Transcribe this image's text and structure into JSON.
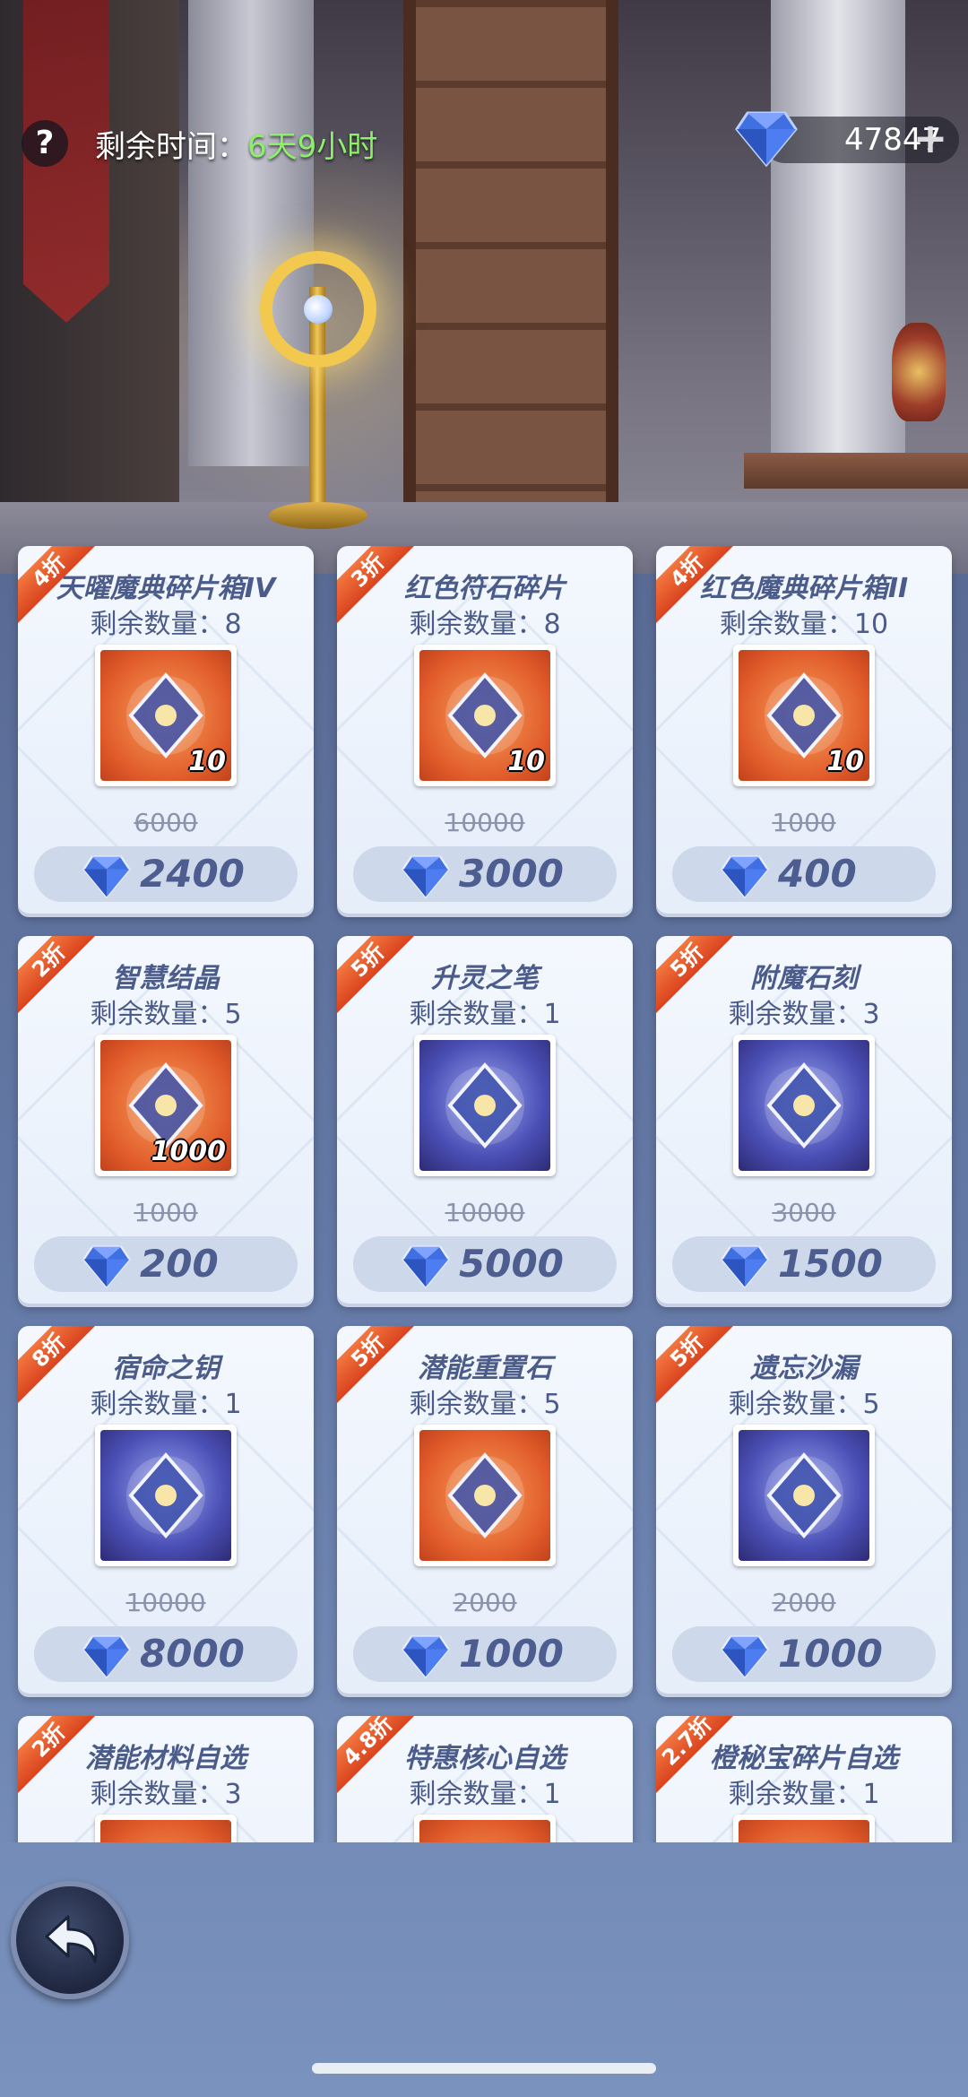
{
  "hud": {
    "help_label": "?",
    "timer_label": "剩余时间：",
    "timer_value": "6天9小时",
    "gem_count": "47847",
    "add_label": "+"
  },
  "icons": {
    "help": "question-icon",
    "currency": "diamond-gem-icon",
    "add": "plus-icon",
    "back": "undo-arrow-icon"
  },
  "colors": {
    "timer_value": "#8ef06a",
    "discount_badge": "#e4552a",
    "price_text": "#4d5d8f",
    "gem": "#3f6fe0"
  },
  "items": [
    {
      "discount": "4折",
      "name": "天曜魔典碎片箱IV",
      "qty": "剩余数量：8",
      "count": "10",
      "old_price": "6000",
      "price": "2400",
      "icon": "treasure-chest-red-icon"
    },
    {
      "discount": "3折",
      "name": "红色符石碎片",
      "qty": "剩余数量：8",
      "count": "10",
      "old_price": "10000",
      "price": "3000",
      "icon": "red-rune-stone-icon"
    },
    {
      "discount": "4折",
      "name": "红色魔典碎片箱II",
      "qty": "剩余数量：10",
      "count": "10",
      "old_price": "1000",
      "price": "400",
      "icon": "treasure-chest-blue-icon"
    },
    {
      "discount": "2折",
      "name": "智慧结晶",
      "qty": "剩余数量：5",
      "count": "1000",
      "old_price": "1000",
      "price": "200",
      "icon": "wisdom-crystal-icon"
    },
    {
      "discount": "5折",
      "name": "升灵之笔",
      "qty": "剩余数量：1",
      "count": "",
      "old_price": "10000",
      "price": "5000",
      "icon": "feather-quill-icon"
    },
    {
      "discount": "5折",
      "name": "附魔石刻",
      "qty": "剩余数量：3",
      "count": "",
      "old_price": "3000",
      "price": "1500",
      "icon": "enchant-stone-icon"
    },
    {
      "discount": "8折",
      "name": "宿命之钥",
      "qty": "剩余数量：1",
      "count": "",
      "old_price": "10000",
      "price": "8000",
      "icon": "fate-key-icon"
    },
    {
      "discount": "5折",
      "name": "潜能重置石",
      "qty": "剩余数量：5",
      "count": "",
      "old_price": "2000",
      "price": "1000",
      "icon": "potential-reset-stone-icon"
    },
    {
      "discount": "5折",
      "name": "遗忘沙漏",
      "qty": "剩余数量：5",
      "count": "",
      "old_price": "2000",
      "price": "1000",
      "icon": "hourglass-icon"
    },
    {
      "discount": "2折",
      "name": "潜能材料自选",
      "qty": "剩余数量：3",
      "count": "",
      "old_price": "",
      "price": "",
      "icon": "material-select-icon"
    },
    {
      "discount": "4.8折",
      "name": "特惠核心自选",
      "qty": "剩余数量：1",
      "count": "",
      "old_price": "",
      "price": "",
      "icon": "core-select-icon"
    },
    {
      "discount": "2.7折",
      "name": "橙秘宝碎片自选",
      "qty": "剩余数量：1",
      "count": "",
      "old_price": "",
      "price": "",
      "icon": "orange-treasure-select-icon"
    }
  ]
}
